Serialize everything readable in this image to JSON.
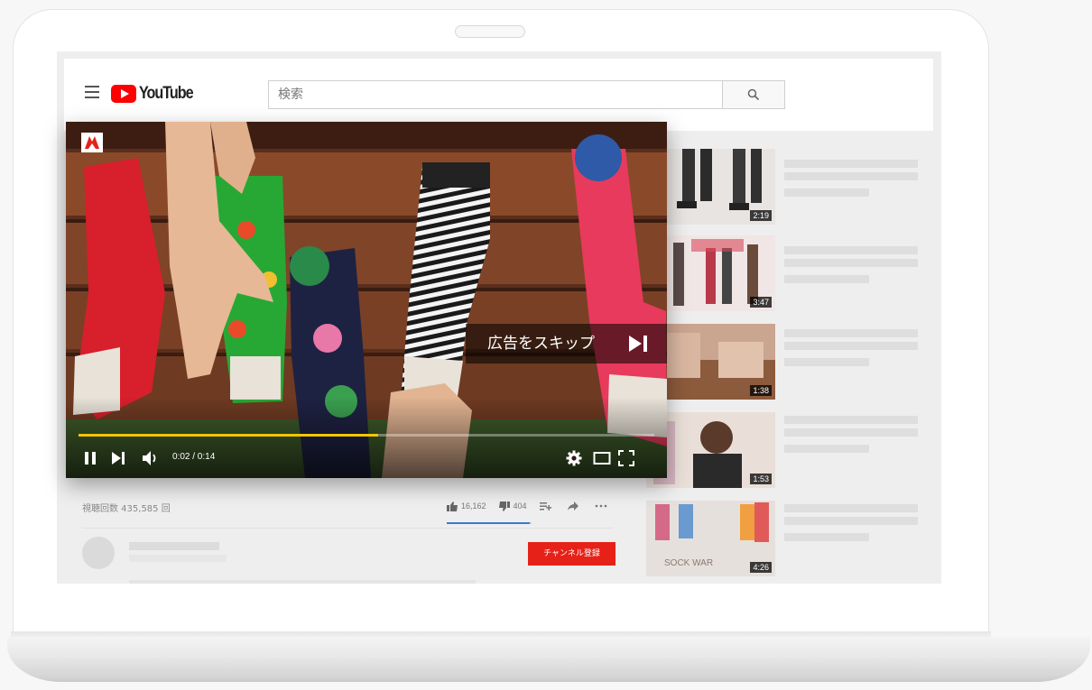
{
  "header": {
    "logo_text": "YouTube",
    "search_placeholder": "検索"
  },
  "player": {
    "skip_ad_label": "広告をスキップ",
    "time_display": "0:02 / 0:14",
    "progress_fraction": 0.52,
    "progress_color": "#f2c600"
  },
  "video_info": {
    "view_count": "視聴回数 435,585 回",
    "likes": "16,162",
    "dislikes": "404",
    "subscribe_label": "チャンネル登録",
    "subscribe_color": "#e62117"
  },
  "sidebar": {
    "items": [
      {
        "duration": "2:19",
        "thumb_icon": "legs-photo"
      },
      {
        "duration": "3:47",
        "thumb_icon": "diy-boot-photo"
      },
      {
        "duration": "1:38",
        "thumb_icon": "socks-photo"
      },
      {
        "duration": "1:53",
        "thumb_icon": "person-photo"
      },
      {
        "duration": "4:26",
        "thumb_icon": "sock-war-photo",
        "thumb_text": "SOCK WAR"
      }
    ]
  },
  "icons": {
    "menu": "hamburger-icon",
    "search": "search-icon",
    "play_pause": "pause-icon",
    "next": "next-icon",
    "volume": "volume-icon",
    "settings": "gear-icon",
    "theater": "theater-icon",
    "fullscreen": "fullscreen-icon"
  }
}
